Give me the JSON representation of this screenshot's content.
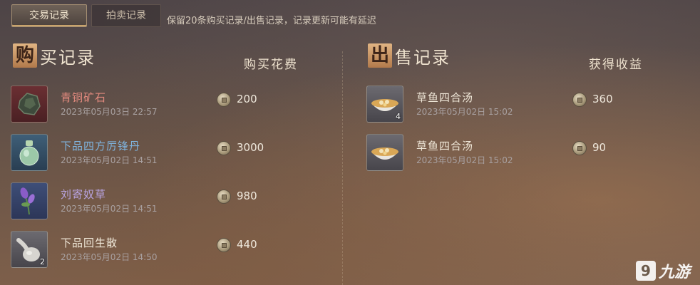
{
  "tabs": {
    "trade_records": "交易记录",
    "auction_records": "拍卖记录"
  },
  "notice": "保留20条购买记录/出售记录，记录更新可能有延迟",
  "purchase": {
    "title_first": "购",
    "title_rest": "买记录",
    "column": "购买花费",
    "items": [
      {
        "name": "青铜矿石",
        "time": "2023年05月03日 22:57",
        "amount": "200",
        "qty": ""
      },
      {
        "name": "下品四方厉锋丹",
        "time": "2023年05月02日 14:51",
        "amount": "3000",
        "qty": ""
      },
      {
        "name": "刘寄奴草",
        "time": "2023年05月02日 14:51",
        "amount": "980",
        "qty": ""
      },
      {
        "name": "下品回生散",
        "time": "2023年05月02日 14:50",
        "amount": "440",
        "qty": "2"
      }
    ]
  },
  "sale": {
    "title_first": "出",
    "title_rest": "售记录",
    "column": "获得收益",
    "items": [
      {
        "name": "草鱼四合汤",
        "time": "2023年05月02日 15:02",
        "amount": "360",
        "qty": "4"
      },
      {
        "name": "草鱼四合汤",
        "time": "2023年05月02日 15:02",
        "amount": "90",
        "qty": ""
      }
    ]
  },
  "watermark": {
    "logo": "9",
    "text": "九游"
  },
  "icons": {
    "ore": "ore-icon",
    "pill_bottle": "pill-bottle-icon",
    "herb": "herb-icon",
    "powder_gourd": "gourd-icon",
    "soup": "soup-bowl-icon",
    "coin": "copper-coin-icon"
  }
}
